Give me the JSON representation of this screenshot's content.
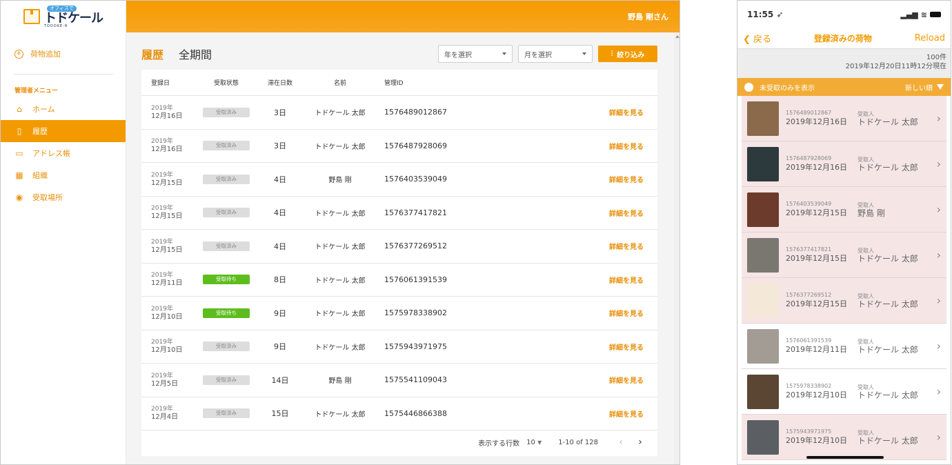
{
  "app": {
    "logo_badge": "オフィスで",
    "logo_text": "トドケール",
    "logo_en": "TODOKE-R",
    "user_label": "野島 剛さん"
  },
  "sidebar": {
    "add_label": "荷物追加",
    "section_title": "管理者メニュー",
    "items": [
      {
        "label": "ホーム",
        "icon": "home-icon"
      },
      {
        "label": "履歴",
        "icon": "clipboard-icon",
        "active": true
      },
      {
        "label": "アドレス帳",
        "icon": "folder-icon"
      },
      {
        "label": "組織",
        "icon": "building-icon"
      },
      {
        "label": "受取場所",
        "icon": "location-pin-icon"
      }
    ]
  },
  "page": {
    "title": "履歴",
    "range": "全期間",
    "year_placeholder": "年を選択",
    "month_placeholder": "月を選択",
    "filter_button": "絞り込み"
  },
  "table": {
    "headers": [
      "登録日",
      "受取状態",
      "滞在日数",
      "名前",
      "管理ID"
    ],
    "rows": [
      {
        "year": "2019年",
        "date": "12月16日",
        "status": "受取済み",
        "waiting": false,
        "days": "3日",
        "name": "トドケール 太郎",
        "id": "1576489012867",
        "action": "詳細を見る"
      },
      {
        "year": "2019年",
        "date": "12月16日",
        "status": "受取済み",
        "waiting": false,
        "days": "3日",
        "name": "トドケール 太郎",
        "id": "1576487928069",
        "action": "詳細を見る"
      },
      {
        "year": "2019年",
        "date": "12月15日",
        "status": "受取済み",
        "waiting": false,
        "days": "4日",
        "name": "野島 剛",
        "id": "1576403539049",
        "action": "詳細を見る"
      },
      {
        "year": "2019年",
        "date": "12月15日",
        "status": "受取済み",
        "waiting": false,
        "days": "4日",
        "name": "トドケール 太郎",
        "id": "1576377417821",
        "action": "詳細を見る"
      },
      {
        "year": "2019年",
        "date": "12月15日",
        "status": "受取済み",
        "waiting": false,
        "days": "4日",
        "name": "トドケール 太郎",
        "id": "1576377269512",
        "action": "詳細を見る"
      },
      {
        "year": "2019年",
        "date": "12月11日",
        "status": "受取待ち",
        "waiting": true,
        "days": "8日",
        "name": "トドケール 太郎",
        "id": "1576061391539",
        "action": "詳細を見る"
      },
      {
        "year": "2019年",
        "date": "12月10日",
        "status": "受取待ち",
        "waiting": true,
        "days": "9日",
        "name": "トドケール 太郎",
        "id": "1575978338902",
        "action": "詳細を見る"
      },
      {
        "year": "2019年",
        "date": "12月10日",
        "status": "受取済み",
        "waiting": false,
        "days": "9日",
        "name": "トドケール 太郎",
        "id": "1575943971975",
        "action": "詳細を見る"
      },
      {
        "year": "2019年",
        "date": "12月5日",
        "status": "受取済み",
        "waiting": false,
        "days": "14日",
        "name": "野島 剛",
        "id": "1575541109043",
        "action": "詳細を見る"
      },
      {
        "year": "2019年",
        "date": "12月4日",
        "status": "受取済み",
        "waiting": false,
        "days": "15日",
        "name": "トドケール 太郎",
        "id": "1575446866388",
        "action": "詳細を見る"
      }
    ],
    "pager": {
      "rows_label": "表示する行数",
      "rows_value": "10",
      "range": "1-10 of 128"
    }
  },
  "phone": {
    "time": "11:55",
    "back": "戻る",
    "title": "登録済みの荷物",
    "reload": "Reload",
    "count": "100件",
    "as_of": "2019年12月20日11時12分現在",
    "unreceived_toggle": "未受取のみを表示",
    "sort": "新しい順",
    "receiver_label": "受取人",
    "items": [
      {
        "id": "1576489012867",
        "date": "2019年12月16日",
        "name": "トドケール 太郎",
        "thumb": "#8a6a4a",
        "white": false
      },
      {
        "id": "1576487928069",
        "date": "2019年12月16日",
        "name": "トドケール 太郎",
        "thumb": "#2d3a3d",
        "white": false
      },
      {
        "id": "1576403539049",
        "date": "2019年12月15日",
        "name": "野島 剛",
        "thumb": "#6d3b2b",
        "white": false
      },
      {
        "id": "1576377417821",
        "date": "2019年12月15日",
        "name": "トドケール 太郎",
        "thumb": "#7a7770",
        "white": false
      },
      {
        "id": "1576377269512",
        "date": "2019年12月15日",
        "name": "トドケール 太郎",
        "thumb": "#f4e8d8",
        "white": false
      },
      {
        "id": "1576061391539",
        "date": "2019年12月11日",
        "name": "トドケール 太郎",
        "thumb": "#a39c94",
        "white": true
      },
      {
        "id": "1575978338902",
        "date": "2019年12月10日",
        "name": "トドケール 太郎",
        "thumb": "#5a4632",
        "white": true
      },
      {
        "id": "1575943971975",
        "date": "2019年12月10日",
        "name": "トドケール 太郎",
        "thumb": "#5b5f63",
        "white": false
      }
    ]
  }
}
